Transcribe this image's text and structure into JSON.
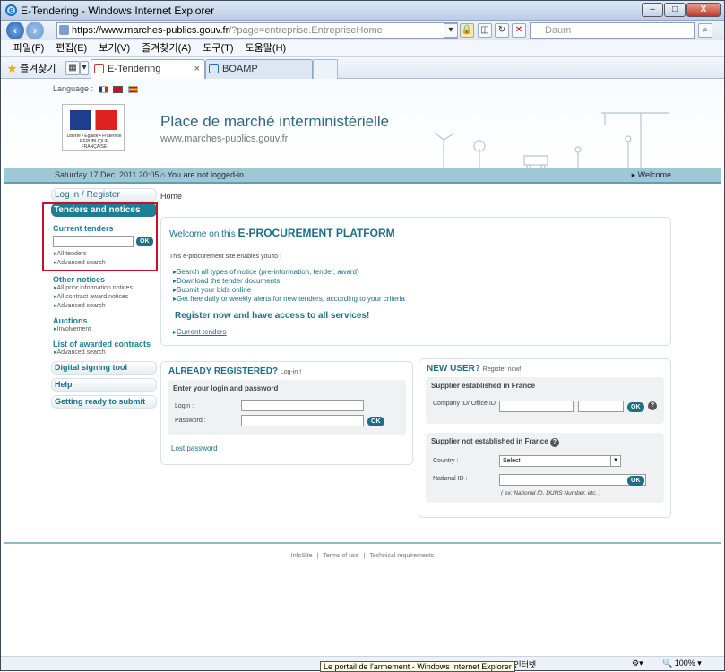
{
  "window": {
    "title": "E-Tendering - Windows Internet Explorer",
    "controls": {
      "min": "–",
      "max": "□",
      "close": "X"
    }
  },
  "address": {
    "host": "https://www.marches-publics.gouv.fr",
    "path": "/?page=entreprise.EntrepriseHome"
  },
  "search": {
    "placeholder": "Daum"
  },
  "menu": [
    "파일(F)",
    "편집(E)",
    "보기(V)",
    "즐겨찾기(A)",
    "도구(T)",
    "도움말(H)"
  ],
  "favorites": {
    "label": "즐겨찾기"
  },
  "tabs": [
    {
      "label": "E-Tendering",
      "close": "×"
    },
    {
      "label": "BOAMP"
    }
  ],
  "header": {
    "language_label": "Language :",
    "title": "Place de marché interministérielle",
    "url": "www.marches-publics.gouv.fr",
    "logo_text": "Liberté • Égalité • Fraternité RÉPUBLIQUE FRANÇAISE"
  },
  "topbar": {
    "date": "Saturday 17 Dec. 2011 20:05",
    "status": "You are not logged-in",
    "welcome": "Welcome"
  },
  "sidebar": {
    "login": "Log in / Register",
    "tenders": "Tenders and notices",
    "current": "Current tenders",
    "ok": "OK",
    "current_links": [
      "All tenders",
      "Advanced search"
    ],
    "other": "Other notices",
    "other_links": [
      "All prior information notices",
      "All contract award notices",
      "Advanced search"
    ],
    "auctions": "Auctions",
    "auctions_links": [
      "Involvement"
    ],
    "awarded": "List of awarded contracts",
    "awarded_links": [
      "Advanced search"
    ],
    "signing": "Digital signing tool",
    "help": "Help",
    "ready": "Getting ready to submit"
  },
  "breadcrumb": "Home",
  "welcome_panel": {
    "title_prefix": "Welcome on this",
    "title_strong": "E-PROCUREMENT PLATFORM",
    "intro": "This e-procurement site enables you to :",
    "bullets": [
      "Search all types of notice (pre-information, tender, award)",
      "Download the tender documents",
      "Submit your bids online",
      "Get free daily or weekly alerts for new tenders, according to your criteria"
    ],
    "register": "Register now and have access to all services!",
    "current_link": "Current tenders"
  },
  "already": {
    "title": "ALREADY REGISTERED?",
    "sub": "Log-in !",
    "box_title": "Enter your login and password",
    "login_label": "Login :",
    "password_label": "Password :",
    "ok": "OK",
    "lost": "Lost password"
  },
  "newuser": {
    "title": "NEW USER?",
    "sub": "Register now!",
    "fr_title": "Supplier established in France",
    "company_label": "Company ID/ Office ID",
    "ok": "OK",
    "help": "?",
    "nonfr_title": "Supplier not established in France",
    "country_label": "Country :",
    "country_value": "Select",
    "national_label": "National ID :",
    "hint": "( ex: National ID, DUNS Number, etc. )"
  },
  "footer": [
    "InfoSite",
    "Terms of use",
    "Technical requirements"
  ],
  "statusbar": {
    "tooltip": "Le portail de l'armement - Windows Internet Explorer",
    "zone": "인터넷",
    "zoom": "100%"
  }
}
